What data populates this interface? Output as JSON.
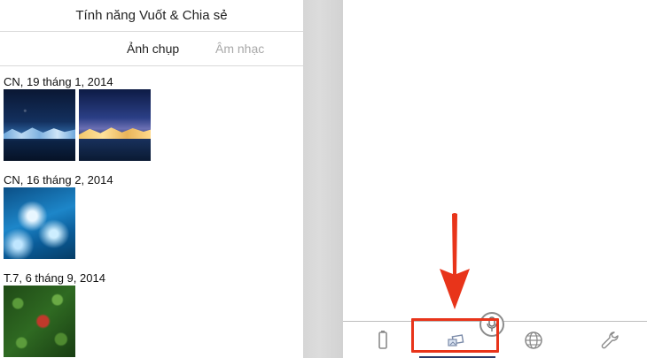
{
  "left_panel": {
    "title": "Tính năng Vuốt & Chia sẻ",
    "tabs": [
      {
        "label": "Ảnh chụp",
        "active": true
      },
      {
        "label": "Âm nhạc",
        "active": false
      }
    ],
    "groups": [
      {
        "date": "CN, 19 tháng 1, 2014",
        "photos": [
          "night-mountain-blue",
          "night-mountain-gold"
        ]
      },
      {
        "date": "CN, 16 tháng 2, 2014",
        "photos": [
          "ocean-wave"
        ]
      },
      {
        "date": "T.7, 6 tháng 9, 2014",
        "photos": [
          "red-leaf-on-clover"
        ]
      }
    ]
  },
  "right_panel": {
    "bottom_bar": {
      "icons": [
        "battery-icon",
        "swipe-share-icon",
        "globe-icon",
        "wrench-icon"
      ],
      "active": "swipe-share-icon"
    },
    "annotation": {
      "color": "#e8341a",
      "target": "swipe-share-icon"
    }
  },
  "colors": {
    "accent": "#e8341a",
    "active_tab_text": "#222222",
    "inactive_tab_text": "#a8a8a8",
    "active_underline": "#2b3b6b"
  }
}
